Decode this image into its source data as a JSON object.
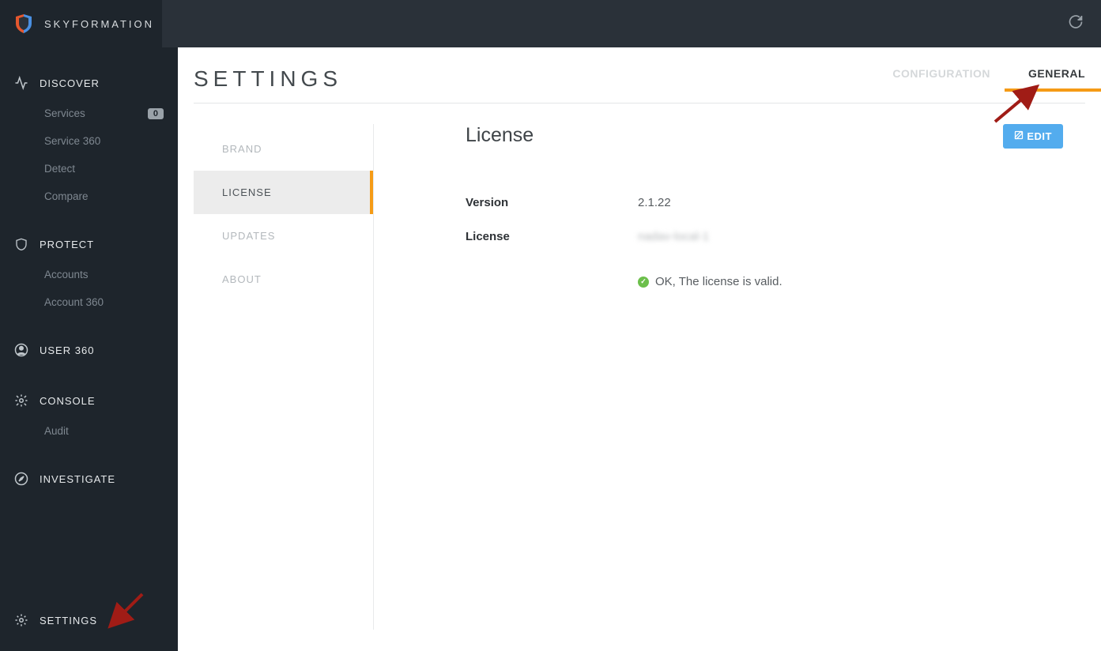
{
  "brand": {
    "name": "SKYFORMATION"
  },
  "sidebar": {
    "sections": [
      {
        "label": "DISCOVER",
        "items": [
          {
            "label": "Services",
            "badge": "0"
          },
          {
            "label": "Service 360"
          },
          {
            "label": "Detect"
          },
          {
            "label": "Compare"
          }
        ]
      },
      {
        "label": "PROTECT",
        "items": [
          {
            "label": "Accounts"
          },
          {
            "label": "Account 360"
          }
        ]
      },
      {
        "label": "USER 360",
        "items": []
      },
      {
        "label": "CONSOLE",
        "items": [
          {
            "label": "Audit"
          }
        ]
      },
      {
        "label": "INVESTIGATE",
        "items": []
      }
    ],
    "bottom": {
      "label": "SETTINGS"
    }
  },
  "page": {
    "title": "SETTINGS",
    "tabs": [
      {
        "label": "CONFIGURATION",
        "active": false
      },
      {
        "label": "GENERAL",
        "active": true
      }
    ]
  },
  "subnav": [
    {
      "label": "BRAND",
      "active": false
    },
    {
      "label": "LICENSE",
      "active": true
    },
    {
      "label": "UPDATES",
      "active": false
    },
    {
      "label": "ABOUT",
      "active": false
    }
  ],
  "panel": {
    "title": "License",
    "edit_label": "EDIT",
    "rows": [
      {
        "key": "Version",
        "value": "2.1.22"
      },
      {
        "key": "License",
        "value": "nadav-local-1",
        "blurred": true
      }
    ],
    "status": "OK, The license is valid."
  }
}
